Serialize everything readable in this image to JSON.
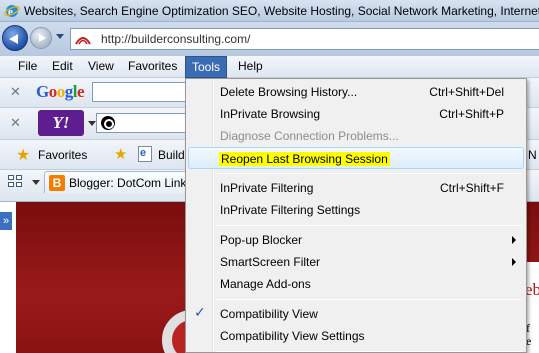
{
  "window": {
    "title": "Websites, Search Engine Optimization SEO, Website Hosting, Social Network Marketing, Internet Bu"
  },
  "nav": {
    "address": "http://builderconsulting.com/"
  },
  "menubar": {
    "items": [
      "File",
      "Edit",
      "View",
      "Favorites",
      "Tools",
      "Help"
    ],
    "active": "Tools"
  },
  "toolbars": {
    "google_logo": "Google",
    "yahoo_logo": "Y!"
  },
  "favorites_bar": {
    "label": "Favorites",
    "link_partial": "Build",
    "overflow_partial": "N"
  },
  "tabs": {
    "items": [
      {
        "label": "Blogger: DotCom Link"
      }
    ]
  },
  "page": {
    "banner_text_partial": "ebs",
    "banner_bits": [
      "f",
      "e"
    ]
  },
  "tools_menu": {
    "items": [
      {
        "label": "Delete Browsing History...",
        "shortcut": "Ctrl+Shift+Del"
      },
      {
        "label": "InPrivate Browsing",
        "shortcut": "Ctrl+Shift+P"
      },
      {
        "label": "Diagnose Connection Problems...",
        "shortcut": "",
        "disabled": true
      },
      {
        "label": "Reopen Last Browsing Session",
        "shortcut": "",
        "highlighted": true
      },
      {
        "label": "InPrivate Filtering",
        "shortcut": "Ctrl+Shift+F"
      },
      {
        "label": "InPrivate Filtering Settings",
        "shortcut": ""
      },
      {
        "label": "Pop-up Blocker",
        "shortcut": "",
        "submenu": true
      },
      {
        "label": "SmartScreen Filter",
        "shortcut": "",
        "submenu": true
      },
      {
        "label": "Manage Add-ons",
        "shortcut": ""
      },
      {
        "label": "Compatibility View",
        "shortcut": "",
        "checked": true
      },
      {
        "label": "Compatibility View Settings",
        "shortcut": ""
      }
    ]
  },
  "colors": {
    "menu_active": "#3a6cb3",
    "highlight_marker": "#ffff00",
    "banner": "#8a1111"
  }
}
